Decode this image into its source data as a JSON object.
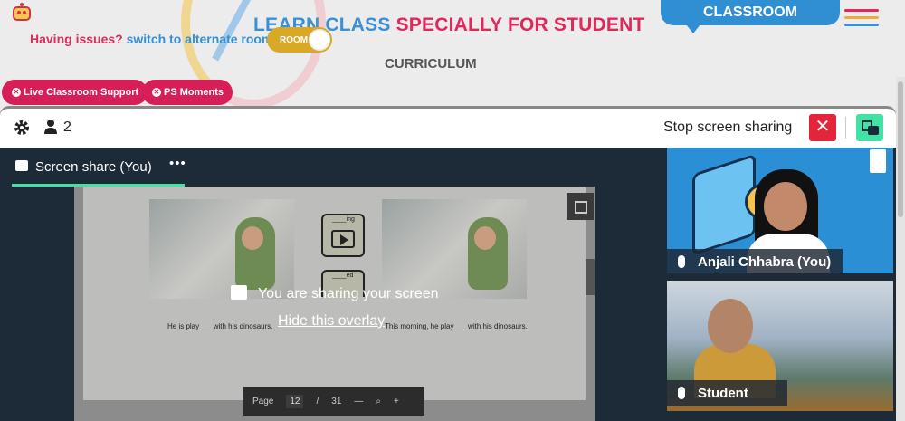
{
  "header": {
    "title_part1": "LEARN CLASS",
    "title_part2": "SPECIALLY FOR STUDENT",
    "issues_text": "Having issues?",
    "issues_link": "switch to alternate room",
    "room_toggle_label": "ROOM",
    "classroom_tab": "CLASSROOM",
    "curriculum": "CURRICULUM",
    "pills": [
      "Live Classroom Support",
      "PS Moments"
    ]
  },
  "toolbar": {
    "participant_count": "2",
    "stop_sharing_label": "Stop screen sharing"
  },
  "share": {
    "tab_label": "Screen share (You)",
    "overlay_title": "You are sharing your screen",
    "overlay_link": "Hide this overlay",
    "doc": {
      "box1_label": "____ing",
      "box2_label": "____ed",
      "sentence1": "He is play___ with his dinosaurs.",
      "sentence2": "This morning, he play___ with his dinosaurs.",
      "pager_label": "Page",
      "page_current": "12",
      "page_sep": "/",
      "page_total": "31"
    }
  },
  "participants": [
    {
      "name": "Anjali Chhabra (You)"
    },
    {
      "name": "Student"
    }
  ],
  "colors": {
    "accent_green": "#41e2a4",
    "stop_red": "#e2253b",
    "brand_blue": "#2f8fd2",
    "brand_pink": "#d61f56"
  }
}
